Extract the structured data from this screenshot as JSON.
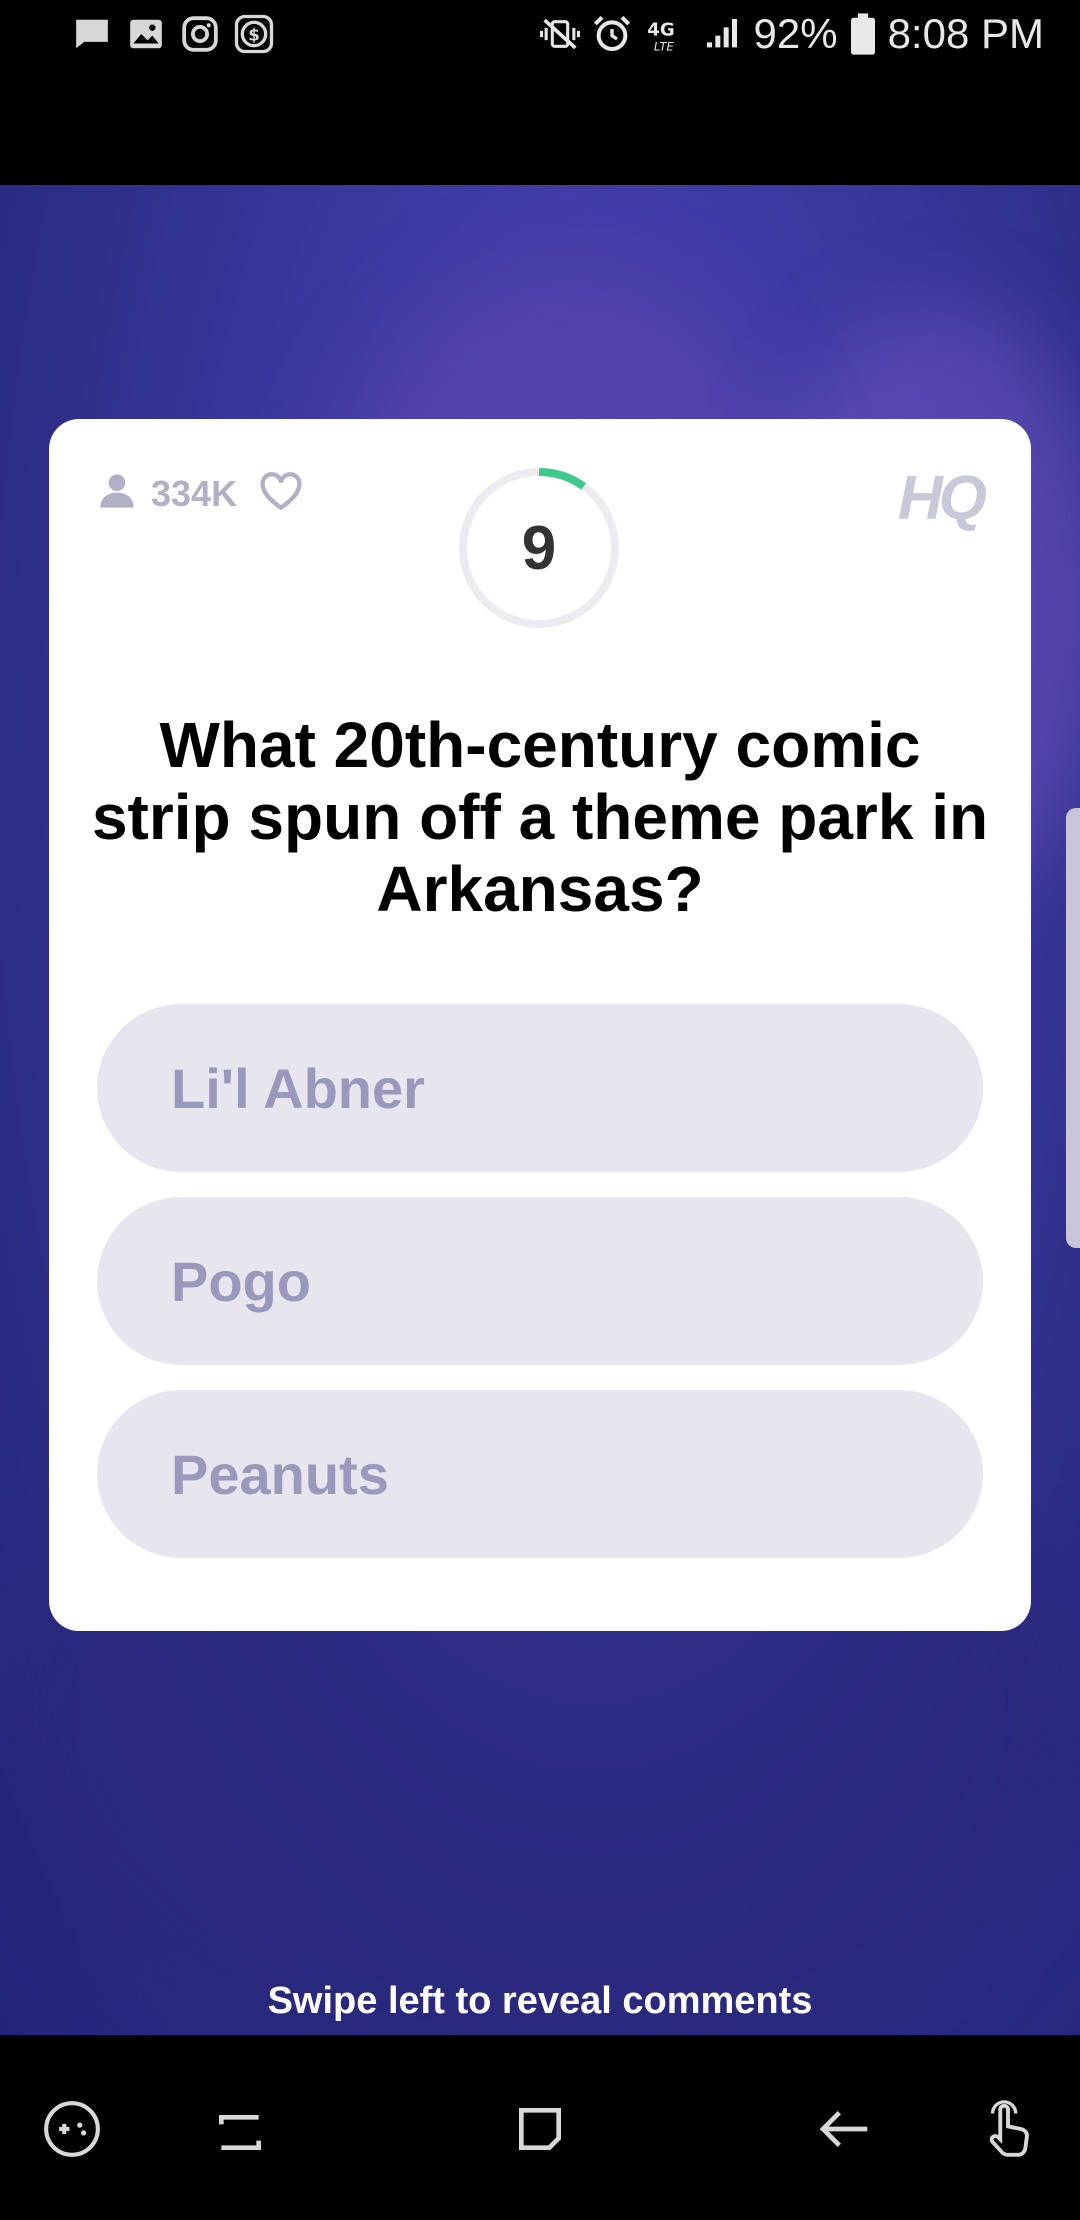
{
  "status_bar": {
    "battery": "92%",
    "time": "8:08 PM",
    "network": "4G LTE",
    "left_icons": [
      "message-icon",
      "image-icon",
      "instagram-icon",
      "cash-icon"
    ],
    "right_icons": [
      "vibrate-icon",
      "alarm-icon",
      "lte-icon",
      "signal-icon",
      "battery-icon"
    ]
  },
  "game": {
    "viewers": "334K",
    "logo": "HQ",
    "timer": "9",
    "timer_progress": 0.1,
    "question": "What 20th-century comic strip spun off a theme park in Arkansas?",
    "answers": [
      {
        "label": "Li'l Abner"
      },
      {
        "label": "Pogo"
      },
      {
        "label": "Peanuts"
      }
    ],
    "swipe_hint": "Swipe left to reveal comments"
  },
  "colors": {
    "accent_timer": "#3cc98a",
    "answer_bg": "#e7e6ef",
    "answer_text": "#9a98bd",
    "background": "#3d3aa3"
  },
  "nav_bar": {
    "icons": [
      "game-tools-icon",
      "recent-apps-icon",
      "home-icon",
      "back-icon",
      "gesture-icon"
    ]
  }
}
